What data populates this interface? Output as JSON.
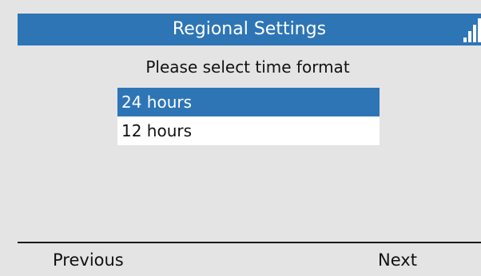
{
  "header": {
    "title": "Regional Settings",
    "signal_icon": "signal-strength-icon",
    "signal_bars": 4
  },
  "prompt": "Please select time format",
  "options": [
    {
      "label": "24 hours",
      "selected": true
    },
    {
      "label": "12 hours",
      "selected": false
    }
  ],
  "softkeys": {
    "left": "Previous",
    "right": "Next"
  },
  "colors": {
    "accent": "#2e75b6",
    "background": "#e4e4e4"
  }
}
